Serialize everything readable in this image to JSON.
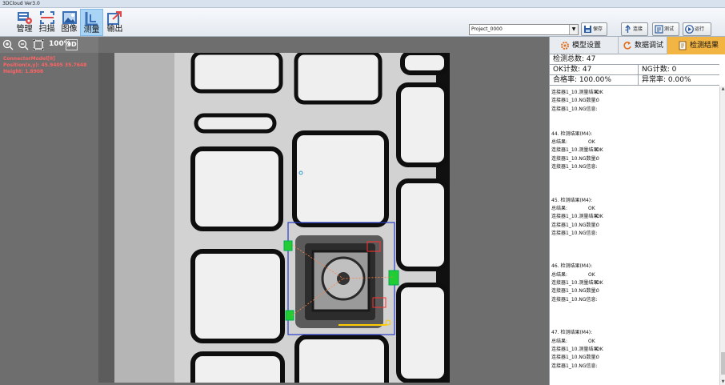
{
  "window": {
    "title": "3DCloud Ver3.0"
  },
  "toolbar": {
    "tools": [
      {
        "label": "管理"
      },
      {
        "label": "扫描"
      },
      {
        "label": "图像"
      },
      {
        "label": "测量"
      },
      {
        "label": "输出"
      }
    ],
    "active_tool": "测量",
    "project": "Project_0000",
    "save_label": "保存",
    "connect_label": "连接",
    "test_label": "测试",
    "run_label": "运行"
  },
  "view": {
    "zoom_label": "100%",
    "mode_3d_label": "3D"
  },
  "overlay": {
    "model": "ConnectorModel[0]",
    "position": "Position(x,y):  45.9405    35.7648",
    "height": "Height:  1.8908"
  },
  "tabs": [
    {
      "label": "模型设置"
    },
    {
      "label": "数据调试"
    },
    {
      "label": "检测结果"
    }
  ],
  "stats": {
    "total_label": "检测总数:",
    "total": "47",
    "ok_label": "OK计数:",
    "ok": "47",
    "ng_label": "NG计数:",
    "ng": "0",
    "pass_label": "合格率:",
    "pass": "100.00%",
    "abnormal_label": "异常率:",
    "abnormal": "0.00%"
  },
  "log": [
    {
      "key": "连接器1_10.测量结果:",
      "val": "OK"
    },
    {
      "key": "连接器1_10.NG数量:",
      "val": "0"
    },
    {
      "key": "连接器1_10.NG信息:",
      "val": ""
    },
    {
      "key": "",
      "val": ""
    },
    {
      "key": "",
      "val": ""
    },
    {
      "key": "44. 检测结果(M4):",
      "val": ""
    },
    {
      "key": "总结果:",
      "val": "OK"
    },
    {
      "key": "连接器1_10.测量结果:",
      "val": "OK"
    },
    {
      "key": "连接器1_10.NG数量:",
      "val": "0"
    },
    {
      "key": "连接器1_10.NG信息:",
      "val": ""
    },
    {
      "key": "",
      "val": ""
    },
    {
      "key": "",
      "val": ""
    },
    {
      "key": "",
      "val": ""
    },
    {
      "key": "45. 检测结果(M4):",
      "val": ""
    },
    {
      "key": "总结果:",
      "val": "OK"
    },
    {
      "key": "连接器1_10.测量结果:",
      "val": "OK"
    },
    {
      "key": "连接器1_10.NG数量:",
      "val": "0"
    },
    {
      "key": "连接器1_10.NG信息:",
      "val": ""
    },
    {
      "key": "",
      "val": ""
    },
    {
      "key": "",
      "val": ""
    },
    {
      "key": "",
      "val": ""
    },
    {
      "key": "46. 检测结果(M4):",
      "val": ""
    },
    {
      "key": "总结果:",
      "val": "OK"
    },
    {
      "key": "连接器1_10.测量结果:",
      "val": "OK"
    },
    {
      "key": "连接器1_10.NG数量:",
      "val": "0"
    },
    {
      "key": "连接器1_10.NG信息:",
      "val": ""
    },
    {
      "key": "",
      "val": ""
    },
    {
      "key": "",
      "val": ""
    },
    {
      "key": "",
      "val": ""
    },
    {
      "key": "47. 检测结果(M4):",
      "val": ""
    },
    {
      "key": "总结果:",
      "val": "OK"
    },
    {
      "key": "连接器1_10.测量结果:",
      "val": "OK"
    },
    {
      "key": "连接器1_10.NG数量:",
      "val": "0"
    },
    {
      "key": "连接器1_10.NG信息:",
      "val": ""
    }
  ],
  "colors": {
    "accent_tab": "#f2b544",
    "active_tool": "#a9d4f5",
    "overlay_text": "#ff6464",
    "roi_box": "#2a3cc8",
    "roi_marker": "#22cc33"
  }
}
